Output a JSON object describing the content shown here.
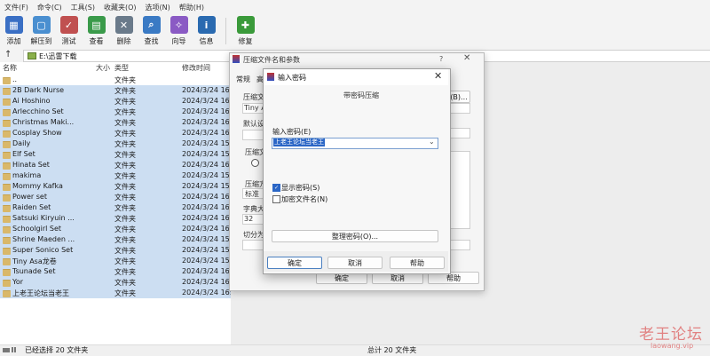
{
  "menu": [
    "文件(F)",
    "命令(C)",
    "工具(S)",
    "收藏夹(O)",
    "选项(N)",
    "帮助(H)"
  ],
  "toolbar": [
    {
      "label": "添加",
      "icon": "winrar-add-icon",
      "color": "#3a6fc4"
    },
    {
      "label": "解压到",
      "icon": "folder-extract-icon",
      "color": "#4a8fd0"
    },
    {
      "label": "测试",
      "icon": "test-clipboard-icon",
      "color": "#c05050"
    },
    {
      "label": "查看",
      "icon": "book-view-icon",
      "color": "#3a9a4a"
    },
    {
      "label": "删除",
      "icon": "trash-icon",
      "color": "#6a7a8a"
    },
    {
      "label": "查找",
      "icon": "magnifier-icon",
      "color": "#3a7ac4"
    },
    {
      "label": "向导",
      "icon": "wizard-wand-icon",
      "color": "#8a5ac4"
    },
    {
      "label": "信息",
      "icon": "info-icon",
      "color": "#2a6ab0"
    },
    {
      "label": "修复",
      "icon": "repair-kit-icon",
      "color": "#3a9a3a"
    }
  ],
  "address": {
    "path": "E:\\迅雷下载"
  },
  "columns": {
    "name": "名称",
    "size": "大小",
    "type": "类型",
    "modified": "修改时间"
  },
  "files": [
    {
      "name": "..",
      "type": "文件夹",
      "date": ""
    },
    {
      "name": "2B Dark Nurse",
      "type": "文件夹",
      "date": "2024/3/24 16:"
    },
    {
      "name": "Ai Hoshino",
      "type": "文件夹",
      "date": "2024/3/24 16:"
    },
    {
      "name": "Arlecchino Set",
      "type": "文件夹",
      "date": "2024/3/24 16:"
    },
    {
      "name": "Christmas Maki...",
      "type": "文件夹",
      "date": "2024/3/24 16:"
    },
    {
      "name": "Cosplay Show",
      "type": "文件夹",
      "date": "2024/3/24 16:"
    },
    {
      "name": "Daily",
      "type": "文件夹",
      "date": "2024/3/24 15:"
    },
    {
      "name": "Elf Set",
      "type": "文件夹",
      "date": "2024/3/24 15:"
    },
    {
      "name": "Hinata Set",
      "type": "文件夹",
      "date": "2024/3/24 16:"
    },
    {
      "name": "makima",
      "type": "文件夹",
      "date": "2024/3/24 15:"
    },
    {
      "name": "Mommy Kafka",
      "type": "文件夹",
      "date": "2024/3/24 15:"
    },
    {
      "name": "Power set",
      "type": "文件夹",
      "date": "2024/3/24 16:"
    },
    {
      "name": "Raiden Set",
      "type": "文件夹",
      "date": "2024/3/24 16:"
    },
    {
      "name": "Satsuki Kiryuin ...",
      "type": "文件夹",
      "date": "2024/3/24 16:"
    },
    {
      "name": "Schoolgirl Set",
      "type": "文件夹",
      "date": "2024/3/24 16:"
    },
    {
      "name": "Shrine Maeden ...",
      "type": "文件夹",
      "date": "2024/3/24 15:"
    },
    {
      "name": "Super Sonico Set",
      "type": "文件夹",
      "date": "2024/3/24 15:"
    },
    {
      "name": "Tiny Asa龙卷",
      "type": "文件夹",
      "date": "2024/3/24 15:"
    },
    {
      "name": "Tsunade Set",
      "type": "文件夹",
      "date": "2024/3/24 16:"
    },
    {
      "name": "Yor",
      "type": "文件夹",
      "date": "2024/3/24 16:"
    },
    {
      "name": "上老王论坛当老王",
      "type": "文件夹",
      "date": "2024/3/24 16:"
    }
  ],
  "back_dialog": {
    "title": "压缩文件名和参数",
    "help": "?",
    "close": "✕",
    "tabs": [
      "常规",
      "高"
    ],
    "archive_label": "压缩文",
    "archive_value": "Tiny A",
    "browse": "(B)...",
    "profile_label": "默认设",
    "format_label": "压缩文",
    "method_label": "压缩方",
    "method_value": "标准",
    "dict_label": "字典大",
    "dict_value": "32",
    "split_label": "切分为",
    "ok": "确定",
    "cancel": "取消",
    "help_btn": "帮助"
  },
  "password_dialog": {
    "title": "输入密码",
    "close": "✕",
    "heading": "带密码压缩",
    "password_label": "输入密码(E)",
    "password_value": "上老王论坛当老王",
    "show_password_label": "显示密码(S)",
    "show_password_checked": true,
    "encrypt_names_label": "加密文件名(N)",
    "encrypt_names_checked": false,
    "manage_label": "整理密码(O)...",
    "ok": "确定",
    "cancel": "取消",
    "help": "帮助"
  },
  "status": {
    "left": "已经选择 20 文件夹",
    "right": "总计 20 文件夹"
  },
  "watermark": {
    "title": "老王论坛",
    "url": "laowang.vip"
  }
}
